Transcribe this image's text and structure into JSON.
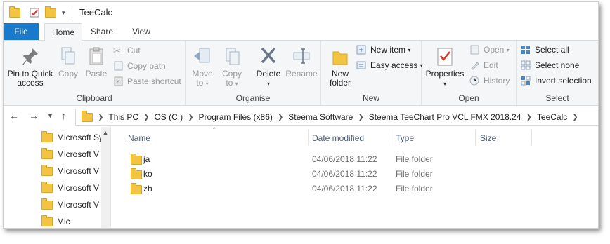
{
  "window": {
    "title": "TeeCalc"
  },
  "tabs": [
    {
      "label": "File"
    },
    {
      "label": "Home"
    },
    {
      "label": "Share"
    },
    {
      "label": "View"
    }
  ],
  "ribbon": {
    "clipboard": {
      "label": "Clipboard",
      "pin": "Pin to Quick access",
      "copy": "Copy",
      "paste": "Paste",
      "cut": "Cut",
      "copy_path": "Copy path",
      "paste_shortcut": "Paste shortcut"
    },
    "organise": {
      "label": "Organise",
      "move_to": "Move to",
      "copy_to": "Copy to",
      "delete": "Delete",
      "rename": "Rename"
    },
    "new": {
      "label": "New",
      "new_folder": "New folder",
      "new_item": "New item",
      "easy_access": "Easy access"
    },
    "open": {
      "label": "Open",
      "properties": "Properties",
      "open": "Open",
      "edit": "Edit",
      "history": "History"
    },
    "select": {
      "label": "Select",
      "select_all": "Select all",
      "select_none": "Select none",
      "invert": "Invert selection"
    }
  },
  "address": {
    "crumbs": [
      "This PC",
      "OS (C:)",
      "Program Files (x86)",
      "Steema Software",
      "Steema TeeChart Pro VCL FMX 2018.24",
      "TeeCalc"
    ]
  },
  "nav_pane": {
    "items": [
      "Microsoft Sy",
      "Microsoft V",
      "Microsoft V",
      "Microsoft V",
      "Microsoft V",
      "Mic"
    ]
  },
  "file_list": {
    "columns": [
      "Name",
      "Date modified",
      "Type",
      "Size"
    ],
    "rows": [
      {
        "name": "ja",
        "date": "04/06/2018 11:22",
        "type": "File folder",
        "size": ""
      },
      {
        "name": "ko",
        "date": "04/06/2018 11:22",
        "type": "File folder",
        "size": ""
      },
      {
        "name": "zh",
        "date": "04/06/2018 11:22",
        "type": "File folder",
        "size": ""
      }
    ]
  },
  "colors": {
    "accent": "#1979ca",
    "folder": "#f3c441",
    "ribbon_bg": "#f5f6f7"
  }
}
